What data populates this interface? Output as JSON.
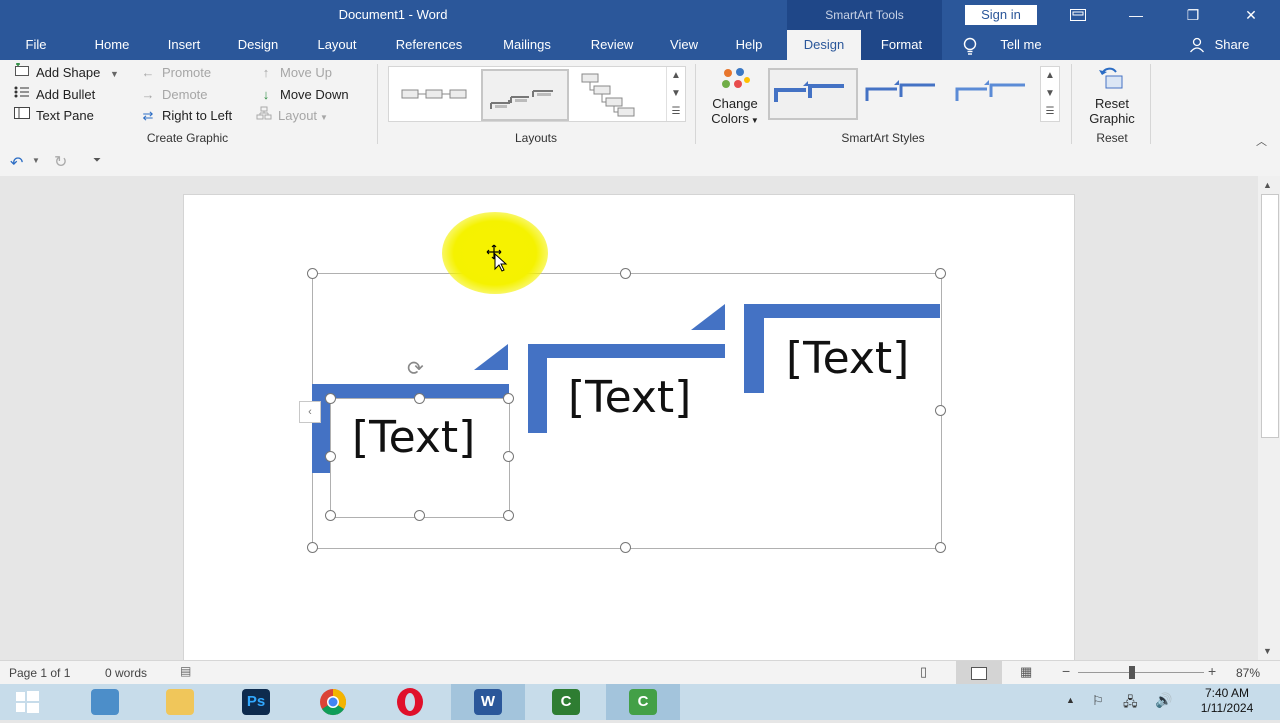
{
  "window": {
    "title": "Document1  -  Word",
    "context_tab": "SmartArt Tools",
    "sign_in": "Sign in",
    "controls": [
      "ribbon-display-icon",
      "minimize-icon",
      "restore-icon",
      "close-icon"
    ]
  },
  "tabs": [
    {
      "label": "File"
    },
    {
      "label": "Home"
    },
    {
      "label": "Insert"
    },
    {
      "label": "Design"
    },
    {
      "label": "Layout"
    },
    {
      "label": "References"
    },
    {
      "label": "Mailings"
    },
    {
      "label": "Review"
    },
    {
      "label": "View"
    },
    {
      "label": "Help"
    },
    {
      "label": "Design",
      "active": true
    },
    {
      "label": "Format"
    },
    {
      "label": "Tell me"
    }
  ],
  "share_label": "Share",
  "ribbon": {
    "create_graphic": {
      "label": "Create Graphic",
      "add_shape": "Add Shape",
      "add_bullet": "Add Bullet",
      "text_pane": "Text Pane",
      "promote": "Promote",
      "demote": "Demote",
      "right_to_left": "Right to Left",
      "move_up": "Move Up",
      "move_down": "Move Down",
      "layout": "Layout"
    },
    "layouts": {
      "label": "Layouts"
    },
    "change_colors": {
      "line1": "Change",
      "line2": "Colors"
    },
    "smartart_styles": {
      "label": "SmartArt Styles"
    },
    "reset": {
      "line1": "Reset",
      "line2": "Graphic",
      "label": "Reset"
    }
  },
  "smartart": {
    "items": [
      {
        "text": "[Text]"
      },
      {
        "text": "[Text]"
      },
      {
        "text": "[Text]"
      }
    ],
    "accent_color": "#4472c4",
    "cursor_highlight_color": "#f5f200"
  },
  "status": {
    "page": "Page 1 of 1",
    "words": "0 words",
    "zoom": "87%"
  },
  "taskbar": {
    "apps": [
      "start-icon",
      "file-manager-icon",
      "file-explorer-icon",
      "photoshop-icon",
      "chrome-icon",
      "opera-icon",
      "word-icon",
      "camtasia-icon",
      "camtasia-recorder-icon"
    ],
    "time": "7:40 AM",
    "date": "1/11/2024"
  }
}
